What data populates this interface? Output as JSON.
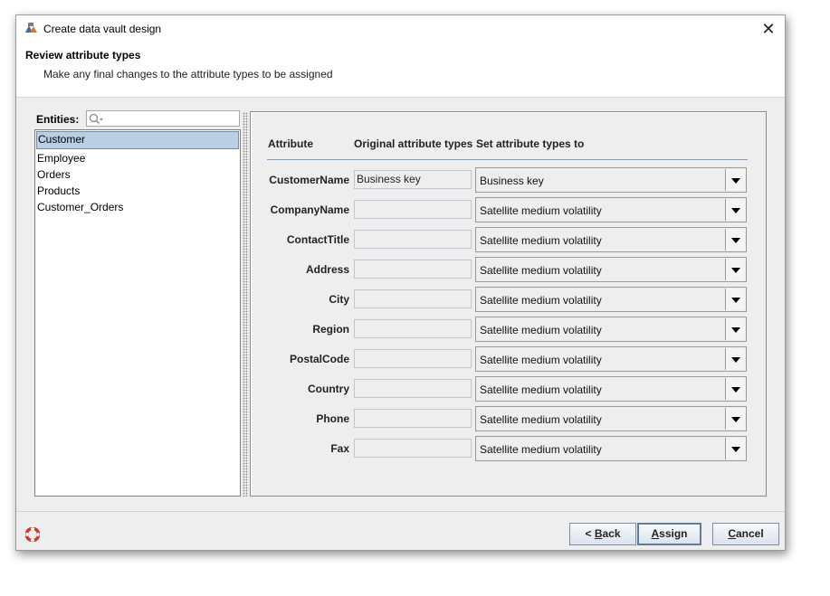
{
  "window": {
    "title": "Create data vault design"
  },
  "header": {
    "title": "Review attribute types",
    "subtitle": "Make any final changes to the attribute types to be assigned"
  },
  "entities": {
    "label": "Entities:",
    "search_placeholder": "",
    "items": [
      "Customer",
      "Employee",
      "Orders",
      "Products",
      "Customer_Orders"
    ],
    "selected_index": 0
  },
  "attributes": {
    "headers": {
      "attribute": "Attribute",
      "original": "Original attribute types",
      "set": "Set attribute types to"
    },
    "rows": [
      {
        "name": "CustomerName",
        "original": "Business key",
        "set": "Business key"
      },
      {
        "name": "CompanyName",
        "original": "",
        "set": "Satellite medium volatility"
      },
      {
        "name": "ContactTitle",
        "original": "",
        "set": "Satellite medium volatility"
      },
      {
        "name": "Address",
        "original": "",
        "set": "Satellite medium volatility"
      },
      {
        "name": "City",
        "original": "",
        "set": "Satellite medium volatility"
      },
      {
        "name": "Region",
        "original": "",
        "set": "Satellite medium volatility"
      },
      {
        "name": "PostalCode",
        "original": "",
        "set": "Satellite medium volatility"
      },
      {
        "name": "Country",
        "original": "",
        "set": "Satellite medium volatility"
      },
      {
        "name": "Phone",
        "original": "",
        "set": "Satellite medium volatility"
      },
      {
        "name": "Fax",
        "original": "",
        "set": "Satellite medium volatility"
      }
    ]
  },
  "buttons": {
    "back": {
      "prefix": "< ",
      "mnemonic": "B",
      "rest": "ack"
    },
    "assign": {
      "mnemonic": "A",
      "rest": "ssign"
    },
    "cancel": {
      "mnemonic": "C",
      "rest": "ancel"
    }
  },
  "icons": {
    "app": "dataflow-app-icon",
    "help": "lifebuoy-help-icon",
    "close": "close-icon",
    "search": "search-icon"
  },
  "colors": {
    "selection": "#b8cfe5",
    "header_rule": "#7a9bbd",
    "window_bg": "#eeeeee"
  }
}
